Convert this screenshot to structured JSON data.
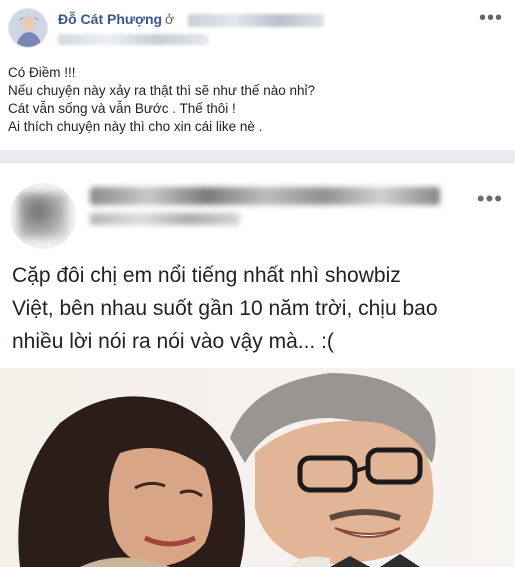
{
  "post": {
    "author": "Đỗ Cát Phượng",
    "location_prefix": "ở",
    "location_icon": "globe-icon",
    "more_icon": "more-dots-icon",
    "caption_lines": [
      "Có Điềm !!!",
      "Nếu chuyện này xảy ra thật thì sẽ như thế nào nhỉ?",
      "Cát vẫn sống và vẫn Bước . Thế thôi !",
      "Ai thích chuyện này thì cho xin cái like nè ."
    ]
  },
  "shared_post": {
    "more_icon": "more-dots-icon",
    "text_lines": [
      "Cặp đôi chị em nổi tiếng nhất nhì showbiz",
      "Việt, bên nhau suốt gần 10 năm trời, chịu bao",
      "nhiều lời nói ra nói vào vậy mà... :("
    ]
  },
  "colors": {
    "author_link": "#365899",
    "text": "#1d2129",
    "separator": "#e9ebee"
  }
}
